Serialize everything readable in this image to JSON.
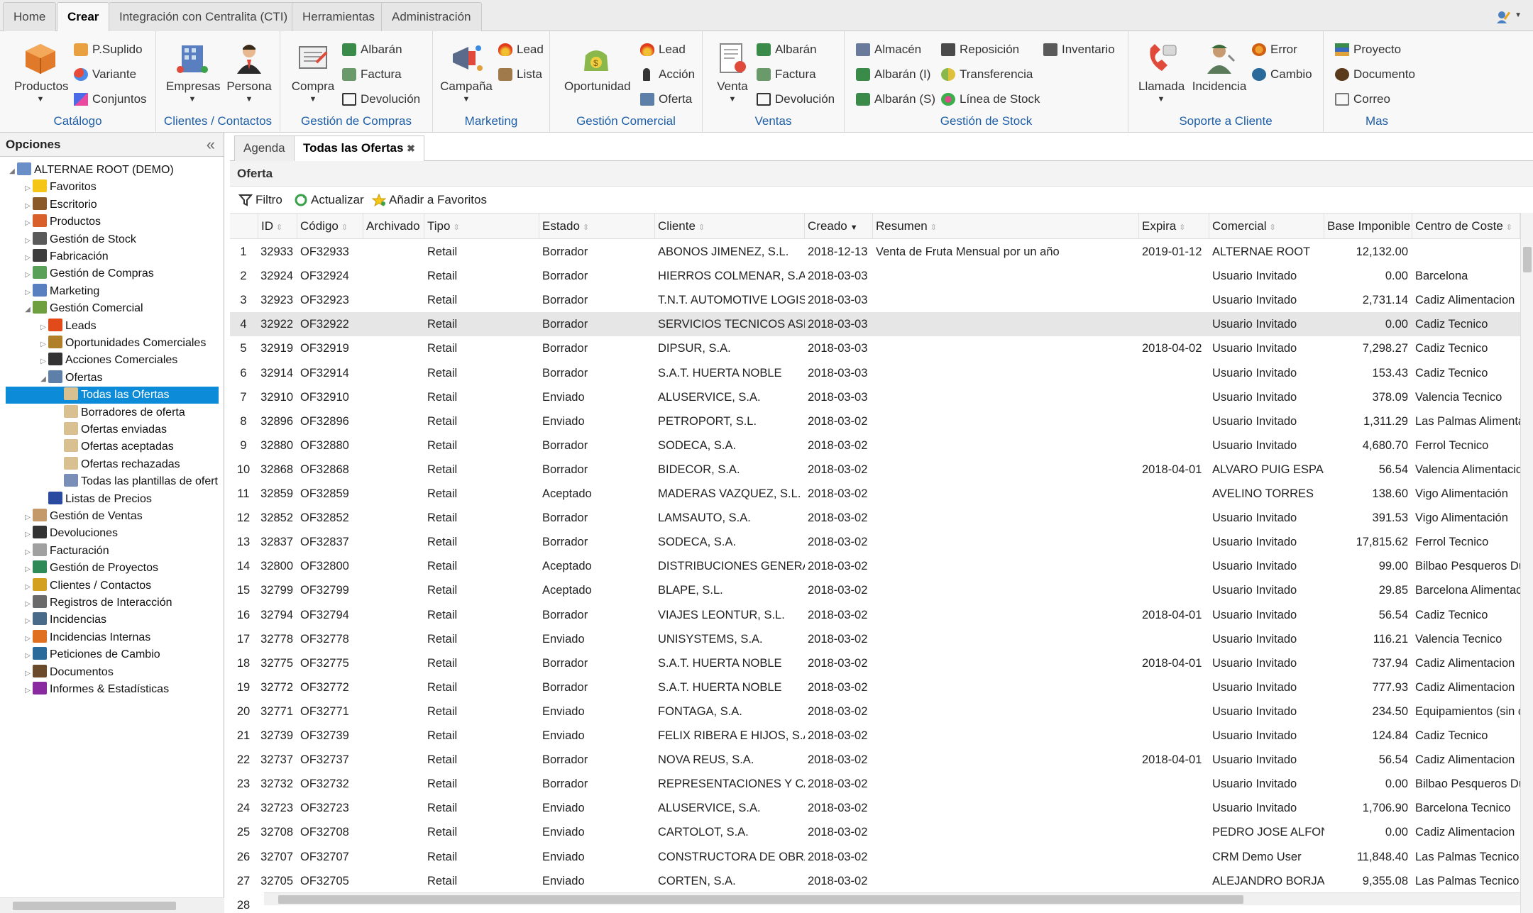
{
  "top_tabs": [
    "Home",
    "Crear",
    "Integración con Centralita (CTI)",
    "Herramientas",
    "Administración"
  ],
  "ribbon": {
    "catalogo": {
      "label": "Catálogo",
      "big": "Productos",
      "small": [
        "P.Suplido",
        "Variante",
        "Conjuntos"
      ]
    },
    "clientes": {
      "label": "Clientes / Contactos",
      "big": [
        "Empresas",
        "Persona"
      ]
    },
    "compras": {
      "label": "Gestión de Compras",
      "big": "Compra",
      "small": [
        "Albarán",
        "Factura",
        "Devolución"
      ]
    },
    "marketing": {
      "label": "Marketing",
      "big": "Campaña",
      "small": [
        "Lead",
        "Lista"
      ]
    },
    "comercial": {
      "label": "Gestión Comercial",
      "big": "Oportunidad",
      "small": [
        "Lead",
        "Acción",
        "Oferta"
      ]
    },
    "ventas": {
      "label": "Ventas",
      "big": "Venta",
      "small": [
        "Albarán",
        "Factura",
        "Devolución"
      ]
    },
    "stock": {
      "label": "Gestión de Stock",
      "small": [
        "Almacén",
        "Albarán (I)",
        "Albarán (S)",
        "Reposición",
        "Transferencia",
        "Línea de Stock",
        "Inventario"
      ]
    },
    "soporte": {
      "label": "Soporte a Cliente",
      "big": [
        "Llamada",
        "Incidencia"
      ],
      "small": [
        "Error",
        "Cambio"
      ]
    },
    "mas": {
      "label": "Mas",
      "small": [
        "Proyecto",
        "Documento",
        "Correo"
      ]
    }
  },
  "left": {
    "title": "Opciones",
    "tree": [
      {
        "label": "ALTERNAE ROOT (DEMO)",
        "level": 0,
        "color": "#6a8fc8"
      },
      {
        "label": "Favoritos",
        "level": 1,
        "color": "#f5c518"
      },
      {
        "label": "Escritorio",
        "level": 1,
        "color": "#8a5a2b"
      },
      {
        "label": "Productos",
        "level": 1,
        "color": "#d9602a"
      },
      {
        "label": "Gestión de Stock",
        "level": 1,
        "color": "#5a5a5a"
      },
      {
        "label": "Fabricación",
        "level": 1,
        "color": "#3d3d3d"
      },
      {
        "label": "Gestión de Compras",
        "level": 1,
        "color": "#5aa05a"
      },
      {
        "label": "Marketing",
        "level": 1,
        "color": "#5a7fc0"
      },
      {
        "label": "Gestión Comercial",
        "level": 1,
        "color": "#6fa040"
      },
      {
        "label": "Leads",
        "level": 2,
        "color": "#e24a1a"
      },
      {
        "label": "Oportunidades Comerciales",
        "level": 2,
        "color": "#b07f2a"
      },
      {
        "label": "Acciones Comerciales",
        "level": 2,
        "color": "#333333"
      },
      {
        "label": "Ofertas",
        "level": 2,
        "color": "#5d7fa8"
      },
      {
        "label": "Todas las Ofertas",
        "level": 3,
        "color": "#d8c090",
        "selected": true
      },
      {
        "label": "Borradores de oferta",
        "level": 3,
        "color": "#d8c090"
      },
      {
        "label": "Ofertas enviadas",
        "level": 3,
        "color": "#d8c090"
      },
      {
        "label": "Ofertas aceptadas",
        "level": 3,
        "color": "#d8c090"
      },
      {
        "label": "Ofertas rechazadas",
        "level": 3,
        "color": "#d8c090"
      },
      {
        "label": "Todas las plantillas de ofert",
        "level": 3,
        "color": "#7a8fb8"
      },
      {
        "label": "Listas de Precios",
        "level": 2,
        "color": "#2a4aa0"
      },
      {
        "label": "Gestión de Ventas",
        "level": 1,
        "color": "#c49a6a"
      },
      {
        "label": "Devoluciones",
        "level": 1,
        "color": "#333333"
      },
      {
        "label": "Facturación",
        "level": 1,
        "color": "#a0a0a0"
      },
      {
        "label": "Gestión de Proyectos",
        "level": 1,
        "color": "#2e8b57"
      },
      {
        "label": "Clientes / Contactos",
        "level": 1,
        "color": "#d4a020"
      },
      {
        "label": "Registros de Interacción",
        "level": 1,
        "color": "#6a6a6a"
      },
      {
        "label": "Incidencias",
        "level": 1,
        "color": "#4a6a8a"
      },
      {
        "label": "Incidencias Internas",
        "level": 1,
        "color": "#e07020"
      },
      {
        "label": "Peticiones de Cambio",
        "level": 1,
        "color": "#2a6a9a"
      },
      {
        "label": "Documentos",
        "level": 1,
        "color": "#6a4a2a"
      },
      {
        "label": "Informes & Estadísticas",
        "level": 1,
        "color": "#8a2aa0"
      }
    ]
  },
  "content_tabs": [
    "Agenda",
    "Todas las Ofertas"
  ],
  "panel_title": "Oferta",
  "toolbar": {
    "filter": "Filtro",
    "refresh": "Actualizar",
    "favorite": "Añadir a Favoritos"
  },
  "columns": [
    "ID",
    "Código",
    "Archivado",
    "Tipo",
    "Estado",
    "Cliente",
    "Creado",
    "Resumen",
    "Expira",
    "Comercial",
    "Base Imponible",
    "Centro de Coste"
  ],
  "rows": [
    [
      "1",
      "32933",
      "OF32933",
      "",
      "Retail",
      "Borrador",
      "ABONOS JIMENEZ, S.L.",
      "2018-12-13",
      "Venta de Fruta Mensual por un año",
      "2019-01-12",
      "ALTERNAE ROOT",
      "12,132.00",
      ""
    ],
    [
      "2",
      "32924",
      "OF32924",
      "",
      "Retail",
      "Borrador",
      "HIERROS COLMENAR, S.A.",
      "2018-03-03",
      "",
      "",
      "Usuario Invitado",
      "0.00",
      "Barcelona"
    ],
    [
      "3",
      "32923",
      "OF32923",
      "",
      "Retail",
      "Borrador",
      "T.N.T. AUTOMOTIVE LOGISTICS ESPAÑA",
      "2018-03-03",
      "",
      "",
      "Usuario Invitado",
      "2,731.14",
      "Cadiz Alimentacion"
    ],
    [
      "4",
      "32922",
      "OF32922",
      "",
      "Retail",
      "Borrador",
      "SERVICIOS TECNICOS ASISTENCALES D",
      "2018-03-03",
      "",
      "",
      "Usuario Invitado",
      "0.00",
      "Cadiz Tecnico"
    ],
    [
      "5",
      "32919",
      "OF32919",
      "",
      "Retail",
      "Borrador",
      "DIPSUR, S.A.",
      "2018-03-03",
      "",
      "2018-04-02",
      "Usuario Invitado",
      "7,298.27",
      "Cadiz Tecnico"
    ],
    [
      "6",
      "32914",
      "OF32914",
      "",
      "Retail",
      "Borrador",
      "S.A.T. HUERTA NOBLE",
      "2018-03-03",
      "",
      "",
      "Usuario Invitado",
      "153.43",
      "Cadiz Tecnico"
    ],
    [
      "7",
      "32910",
      "OF32910",
      "",
      "Retail",
      "Enviado",
      "ALUSERVICE, S.A.",
      "2018-03-03",
      "",
      "",
      "Usuario Invitado",
      "378.09",
      "Valencia Tecnico"
    ],
    [
      "8",
      "32896",
      "OF32896",
      "",
      "Retail",
      "Enviado",
      "PETROPORT, S.L.",
      "2018-03-02",
      "",
      "",
      "Usuario Invitado",
      "1,311.29",
      "Las Palmas Alimenta"
    ],
    [
      "9",
      "32880",
      "OF32880",
      "",
      "Retail",
      "Borrador",
      "SODECA, S.A.",
      "2018-03-02",
      "",
      "",
      "Usuario Invitado",
      "4,680.70",
      "Ferrol Tecnico"
    ],
    [
      "10",
      "32868",
      "OF32868",
      "",
      "Retail",
      "Borrador",
      "BIDECOR, S.A.",
      "2018-03-02",
      "",
      "2018-04-01",
      "ALVARO PUIG ESPASA",
      "56.54",
      "Valencia Alimentacio"
    ],
    [
      "11",
      "32859",
      "OF32859",
      "",
      "Retail",
      "Aceptado",
      "MADERAS VAZQUEZ, S.L.",
      "2018-03-02",
      "",
      "",
      "AVELINO TORRES",
      "138.60",
      "Vigo Alimentación"
    ],
    [
      "12",
      "32852",
      "OF32852",
      "",
      "Retail",
      "Borrador",
      "LAMSAUTO, S.A.",
      "2018-03-02",
      "",
      "",
      "Usuario Invitado",
      "391.53",
      "Vigo Alimentación"
    ],
    [
      "13",
      "32837",
      "OF32837",
      "",
      "Retail",
      "Borrador",
      "SODECA, S.A.",
      "2018-03-02",
      "",
      "",
      "Usuario Invitado",
      "17,815.62",
      "Ferrol Tecnico"
    ],
    [
      "14",
      "32800",
      "OF32800",
      "",
      "Retail",
      "Aceptado",
      "DISTRIBUCIONES GENERALES DE PAQU",
      "2018-03-02",
      "",
      "",
      "Usuario Invitado",
      "99.00",
      "Bilbao Pesqueros Du"
    ],
    [
      "15",
      "32799",
      "OF32799",
      "",
      "Retail",
      "Aceptado",
      "BLAPE, S.L.",
      "2018-03-02",
      "",
      "",
      "Usuario Invitado",
      "29.85",
      "Barcelona Alimentac"
    ],
    [
      "16",
      "32794",
      "OF32794",
      "",
      "Retail",
      "Borrador",
      "VIAJES LEONTUR, S.L.",
      "2018-03-02",
      "",
      "2018-04-01",
      "Usuario Invitado",
      "56.54",
      "Cadiz Tecnico"
    ],
    [
      "17",
      "32778",
      "OF32778",
      "",
      "Retail",
      "Enviado",
      "UNISYSTEMS, S.A.",
      "2018-03-02",
      "",
      "",
      "Usuario Invitado",
      "116.21",
      "Valencia Tecnico"
    ],
    [
      "18",
      "32775",
      "OF32775",
      "",
      "Retail",
      "Borrador",
      "S.A.T. HUERTA NOBLE",
      "2018-03-02",
      "",
      "2018-04-01",
      "Usuario Invitado",
      "737.94",
      "Cadiz Alimentacion"
    ],
    [
      "19",
      "32772",
      "OF32772",
      "",
      "Retail",
      "Borrador",
      "S.A.T. HUERTA NOBLE",
      "2018-03-02",
      "",
      "",
      "Usuario Invitado",
      "777.93",
      "Cadiz Alimentacion"
    ],
    [
      "20",
      "32771",
      "OF32771",
      "",
      "Retail",
      "Enviado",
      "FONTAGA, S.A.",
      "2018-03-02",
      "",
      "",
      "Usuario Invitado",
      "234.50",
      "Equipamientos (sin c"
    ],
    [
      "21",
      "32739",
      "OF32739",
      "",
      "Retail",
      "Enviado",
      "FELIX RIBERA E HIJOS, S.A.",
      "2018-03-02",
      "",
      "",
      "Usuario Invitado",
      "124.84",
      "Cadiz Tecnico"
    ],
    [
      "22",
      "32737",
      "OF32737",
      "",
      "Retail",
      "Borrador",
      "NOVA REUS, S.A.",
      "2018-03-02",
      "",
      "2018-04-01",
      "Usuario Invitado",
      "56.54",
      "Cadiz Alimentacion"
    ],
    [
      "23",
      "32732",
      "OF32732",
      "",
      "Retail",
      "Borrador",
      "REPRESENTACIONES Y CALEFACCION, S",
      "2018-03-02",
      "",
      "",
      "Usuario Invitado",
      "0.00",
      "Bilbao Pesqueros Du"
    ],
    [
      "24",
      "32723",
      "OF32723",
      "",
      "Retail",
      "Enviado",
      "ALUSERVICE, S.A.",
      "2018-03-02",
      "",
      "",
      "Usuario Invitado",
      "1,706.90",
      "Barcelona Tecnico"
    ],
    [
      "25",
      "32708",
      "OF32708",
      "",
      "Retail",
      "Enviado",
      "CARTOLOT, S.A.",
      "2018-03-02",
      "",
      "",
      "PEDRO JOSE ALFONS",
      "0.00",
      "Cadiz Alimentacion"
    ],
    [
      "26",
      "32707",
      "OF32707",
      "",
      "Retail",
      "Enviado",
      "CONSTRUCTORA DE OBRAS PUBLICAS A",
      "2018-03-02",
      "",
      "",
      "CRM Demo User",
      "11,848.40",
      "Las Palmas Tecnico"
    ],
    [
      "27",
      "32705",
      "OF32705",
      "",
      "Retail",
      "Enviado",
      "CORTEN, S.A.",
      "2018-03-02",
      "",
      "",
      "ALEJANDRO BORJA M",
      "9,355.08",
      "Las Palmas Tecnico"
    ],
    [
      "28",
      "",
      "",
      "",
      "",
      "",
      "",
      "",
      "",
      "",
      "",
      "",
      ""
    ]
  ]
}
